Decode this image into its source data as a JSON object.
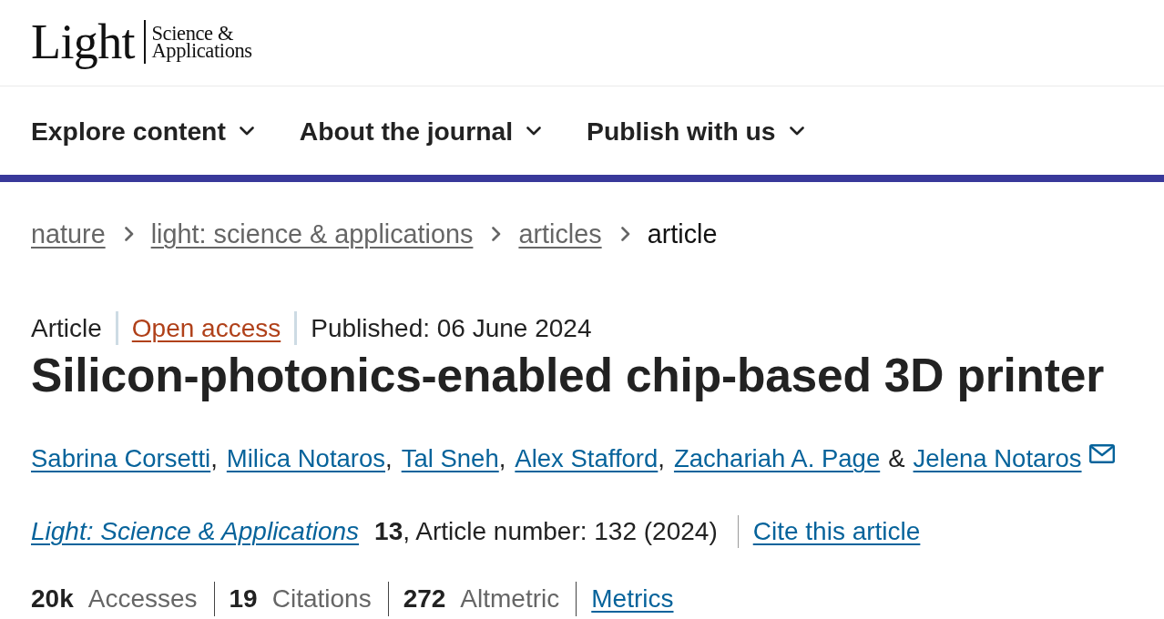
{
  "logo": {
    "wordmark": "Light",
    "subtitle": [
      "Science &",
      "Applications"
    ]
  },
  "nav": [
    {
      "label": "Explore content"
    },
    {
      "label": "About the journal"
    },
    {
      "label": "Publish with us"
    }
  ],
  "breadcrumbs": [
    {
      "label": "nature",
      "kind": "link"
    },
    {
      "label": "light: science & applications",
      "kind": "link"
    },
    {
      "label": "articles",
      "kind": "link"
    },
    {
      "label": "article",
      "kind": "current"
    }
  ],
  "article": {
    "meta": [
      {
        "label": "Article",
        "kind": "type"
      },
      {
        "label": "Open access",
        "kind": "access"
      },
      {
        "label": "Published: 06 June 2024",
        "kind": "date"
      }
    ],
    "title": "Silicon-photonics-enabled chip-based 3D printer",
    "authors": [
      {
        "name": "Sabrina Corsetti",
        "separator_after": ",",
        "contact": false
      },
      {
        "name": "Milica Notaros",
        "separator_after": ",",
        "contact": false
      },
      {
        "name": "Tal Sneh",
        "separator_after": ",",
        "contact": false
      },
      {
        "name": "Alex Stafford",
        "separator_after": ",",
        "contact": false
      },
      {
        "name": "Zachariah A. Page",
        "contact": false
      },
      {
        "joiner_before": "&",
        "name": "Jelena Notaros",
        "contact": true
      }
    ],
    "citation": {
      "journal": "Light: Science & Applications",
      "details": "**13**, Article number: 132 (2024)",
      "cite_link": "Cite this article"
    },
    "metrics": [
      {
        "count": "20k",
        "name": "Accesses"
      },
      {
        "count": "19",
        "name": "Citations"
      },
      {
        "count": "272",
        "name": "Altmetric"
      }
    ],
    "metrics_link": "Metrics"
  }
}
